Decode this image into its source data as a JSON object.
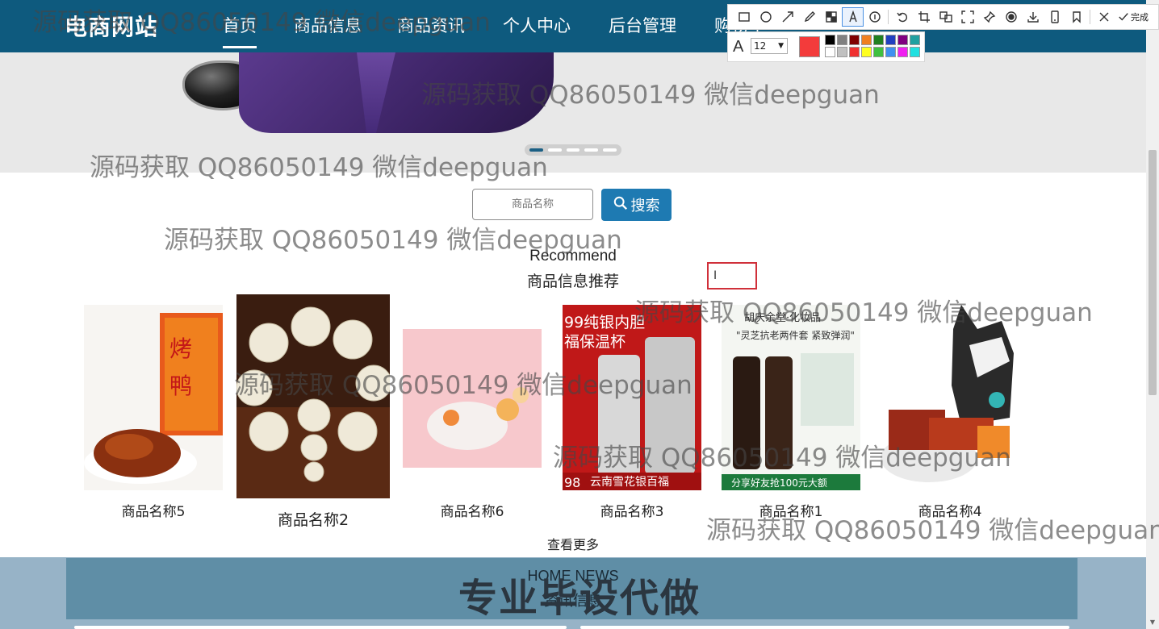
{
  "brand": "电商网站",
  "nav": [
    {
      "label": "首页",
      "active": true
    },
    {
      "label": "商品信息"
    },
    {
      "label": "商品资讯"
    },
    {
      "label": "个人中心"
    },
    {
      "label": "后台管理"
    },
    {
      "label": "购物车"
    }
  ],
  "search": {
    "placeholder": "商品名称",
    "button_label": "搜索"
  },
  "recommend": {
    "title_en": "Recommend",
    "title_cn": "商品信息推荐"
  },
  "products": [
    {
      "name": "商品名称5",
      "image": "roast-duck"
    },
    {
      "name": "商品名称2",
      "image": "bead-bracelet"
    },
    {
      "name": "商品名称6",
      "image": "candy-dessert"
    },
    {
      "name": "商品名称3",
      "image": "thermos-cup"
    },
    {
      "name": "商品名称1",
      "image": "cosmetics-set"
    },
    {
      "name": "商品名称4",
      "image": "cat-snacks"
    }
  ],
  "view_more": "查看更多",
  "news": {
    "title_en": "HOME NEWS",
    "title_cn": "资讯信息"
  },
  "overlay_text": "专业毕设代做",
  "watermark": "源码获取 QQ86050149 微信deepguan",
  "toolbar": {
    "done_label": "完成",
    "font_size": "12",
    "current_color": "#f33b3b",
    "palette": [
      "#000000",
      "#808080",
      "#800000",
      "#f08020",
      "#208020",
      "#2040c0",
      "#800080",
      "#20a0a0",
      "#ffffff",
      "#c0c0c0",
      "#f03030",
      "#ffff20",
      "#40c040",
      "#4090f0",
      "#f020f0",
      "#20e0e0"
    ]
  },
  "colors": {
    "navbar": "#0e5a7e",
    "search_button": "#1e7ab2",
    "footer_band": "#97b3c7",
    "news_box": "#5f8ea6"
  }
}
